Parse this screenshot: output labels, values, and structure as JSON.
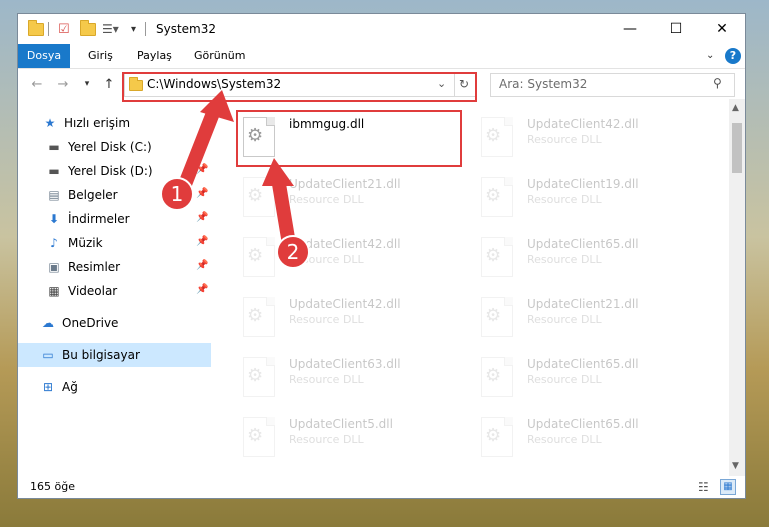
{
  "window": {
    "title": "System32",
    "controls": {
      "minimize": "—",
      "maximize": "☐",
      "close": "✕"
    }
  },
  "ribbon": {
    "tabs": [
      {
        "label": "Dosya",
        "active": true
      },
      {
        "label": "Giriş"
      },
      {
        "label": "Paylaş"
      },
      {
        "label": "Görünüm"
      }
    ],
    "help": "?"
  },
  "navigation": {
    "address": "C:\\Windows\\System32",
    "search_placeholder": "Ara: System32"
  },
  "sidebar": {
    "quick_access": "Hızlı erişim",
    "items": [
      {
        "label": "Yerel Disk (C:)",
        "icon": "drive-icon"
      },
      {
        "label": "Yerel Disk (D:)",
        "icon": "drive-icon"
      },
      {
        "label": "Belgeler",
        "icon": "documents-icon"
      },
      {
        "label": "İndirmeler",
        "icon": "download-icon"
      },
      {
        "label": "Müzik",
        "icon": "music-icon"
      },
      {
        "label": "Resimler",
        "icon": "pictures-icon"
      },
      {
        "label": "Videolar",
        "icon": "videos-icon"
      }
    ],
    "onedrive": "OneDrive",
    "this_pc": "Bu bilgisayar",
    "network": "Ağ"
  },
  "files": {
    "left": [
      {
        "name": "ibmmgug.dll",
        "type": ""
      },
      {
        "name": "UpdateClient21.dll",
        "type": "Resource DLL"
      },
      {
        "name": "UpdateClient42.dll",
        "type": "Resource DLL"
      },
      {
        "name": "UpdateClient42.dll",
        "type": "Resource DLL"
      },
      {
        "name": "UpdateClient63.dll",
        "type": "Resource DLL"
      },
      {
        "name": "UpdateClient5.dll",
        "type": "Resource DLL"
      }
    ],
    "right": [
      {
        "name": "UpdateClient42.dll",
        "type": "Resource DLL"
      },
      {
        "name": "UpdateClient19.dll",
        "type": "Resource DLL"
      },
      {
        "name": "UpdateClient65.dll",
        "type": "Resource DLL"
      },
      {
        "name": "UpdateClient21.dll",
        "type": "Resource DLL"
      },
      {
        "name": "UpdateClient65.dll",
        "type": "Resource DLL"
      },
      {
        "name": "UpdateClient65.dll",
        "type": "Resource DLL"
      }
    ]
  },
  "status": {
    "count": "165 öğe"
  },
  "annotations": {
    "step1": "1",
    "step2": "2",
    "color": "#e03c3c"
  }
}
